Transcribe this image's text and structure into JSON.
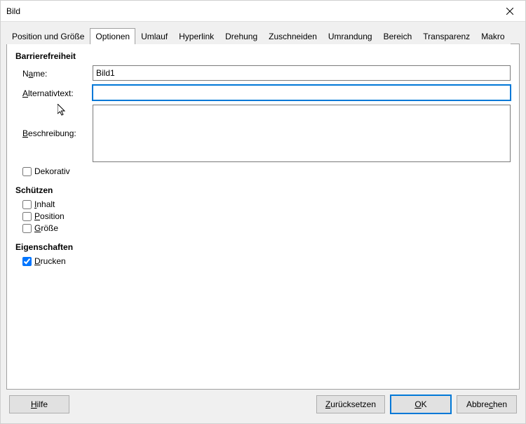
{
  "window": {
    "title": "Bild"
  },
  "tabs": {
    "t0": "Position und Größe",
    "t1": "Optionen",
    "t2": "Umlauf",
    "t3": "Hyperlink",
    "t4": "Drehung",
    "t5": "Zuschneiden",
    "t6": "Umrandung",
    "t7": "Bereich",
    "t8": "Transparenz",
    "t9": "Makro",
    "active": "Optionen"
  },
  "a11y": {
    "group": "Barrierefreiheit",
    "name_label_pre": "N",
    "name_label_u": "a",
    "name_label_post": "me:",
    "name_value": "Bild1",
    "alt_label_u": "A",
    "alt_label_post": "lternativtext:",
    "alt_value": "",
    "desc_label_u": "B",
    "desc_label_post": "eschreibung:",
    "desc_value": "",
    "decorative_label": "Dekorativ",
    "decorative_checked": false
  },
  "protect": {
    "group": "Schützen",
    "content_label": "I",
    "content_label_post": "nhalt",
    "position_label": "P",
    "position_label_post": "osition",
    "size_label": "G",
    "size_label_post": "röße",
    "content_checked": false,
    "position_checked": false,
    "size_checked": false
  },
  "props": {
    "group": "Eigenschaften",
    "print_label": "D",
    "print_label_post": "rucken",
    "print_checked": true
  },
  "buttons": {
    "help_u": "H",
    "help_post": "ilfe",
    "reset_u": "Z",
    "reset_post": "urücksetzen",
    "ok_u": "O",
    "ok_post": "K",
    "cancel": "Abbre",
    "cancel_u": "c",
    "cancel_post": "hen"
  }
}
